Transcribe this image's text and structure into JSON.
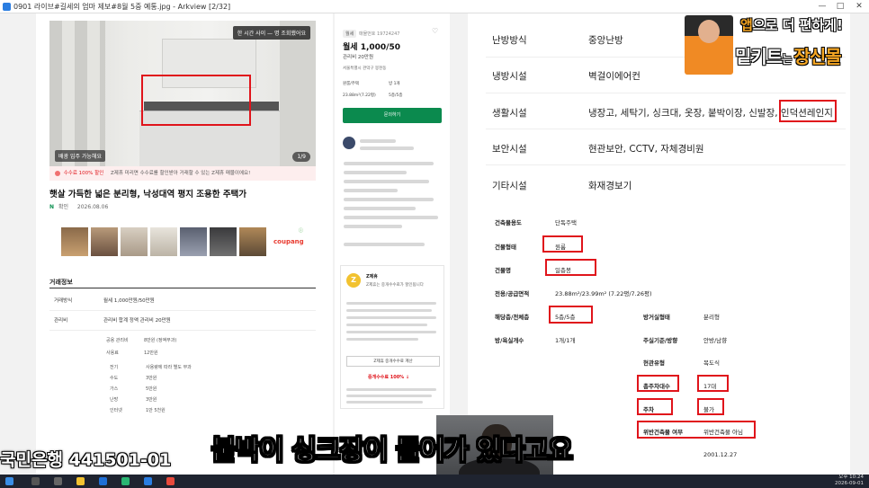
{
  "window": {
    "title": "0901 라이브#길세의 엄마 제보#8월 5중 예통.jpg - Arkview [2/32]",
    "min_btn": "—",
    "max_btn": "□",
    "close_btn": "✕"
  },
  "listing": {
    "photo_badge": "한 시간 사이 — 명 조회했어요",
    "photo_tag": "배광 입주 가능해요",
    "photo_count": "1/9",
    "notice_label": "수수료 100% 할인",
    "notice_text": "Z제휴 미리면 수수료를 할인받아 거래할 수 있는 Z제휴 매물이에요!",
    "title": "햇살 가득한 넓은 분리형, 낙성대역 평지 조용한 주택가",
    "verify_mark": "N",
    "verify_label": "확인",
    "verify_date": "2026.08.06",
    "ad_mark": "ⓘ",
    "coupang": "coupang",
    "section": "거래정보",
    "rows": [
      {
        "k": "거래방식",
        "v": "월세  1,000만원/50만원"
      },
      {
        "k": "관리비",
        "v": "관리비 합계     정액 관리비 20만원"
      }
    ],
    "sub_rows": [
      {
        "k": "공용 관리비",
        "v": "8만원 (정액부과)"
      },
      {
        "k": "사용료",
        "v": "12만원"
      },
      {
        "k": "전기",
        "v": "사용량에 따라 별도 부과"
      },
      {
        "k": "수도",
        "v": "3만원"
      },
      {
        "k": "가스",
        "v": "5만원"
      },
      {
        "k": "난방",
        "v": "3만원"
      },
      {
        "k": "인터넷",
        "v": "1만 5천원"
      }
    ]
  },
  "summary": {
    "chip": "월세",
    "regno": "매물번호 19724247",
    "heart": "♡",
    "price": "월세 1,000/50",
    "fee": "관리비 20만원",
    "addr": "서울특별시 관악구 봉천동",
    "specs": [
      "원룸/주택",
      "방 1개",
      "23.88m²(7.22평)",
      "5층/5층"
    ],
    "button": "문의하기",
    "z_logo": "Z",
    "z_title": "Z제휴",
    "z_sub": "Z제휴는 중개수수료가 할인됩니다",
    "z_btn": "Z제휴 중개수수료 계산",
    "z_pct": "중개수수료 100% ↓"
  },
  "details": {
    "big": [
      {
        "k": "난방방식",
        "v": "중앙난방"
      },
      {
        "k": "냉방시설",
        "v": "벽걸이에어컨"
      },
      {
        "k": "생활시설",
        "v": "냉장고, 세탁기, 싱크대, 옷장, 붙박이장, 신발장, 인덕션레인지"
      },
      {
        "k": "보안시설",
        "v": "현관보안, CCTV, 자체경비원"
      },
      {
        "k": "기타시설",
        "v": "화재경보기"
      }
    ],
    "small_left": [
      {
        "k": "건축물용도",
        "v": "단독주택"
      },
      {
        "k": "건물형태",
        "v": "원룸"
      },
      {
        "k": "건물명",
        "v": "일층봉"
      },
      {
        "k": "전용/공급면적",
        "v": "23.88m²/23.99m² (7.22평/7.26평)"
      },
      {
        "k": "해당층/전체층",
        "v": "5층/5층"
      },
      {
        "k": "방/욕실개수",
        "v": "1개/1개"
      }
    ],
    "small_right": [
      {
        "k": "방거실형태",
        "v": "분리형"
      },
      {
        "k": "주실기준/방향",
        "v": "안방/남향"
      },
      {
        "k": "현관유형",
        "v": "복도식"
      },
      {
        "k": "총주차대수",
        "v": "17대"
      },
      {
        "k": "주차",
        "v": "불가"
      },
      {
        "k": "위반건축물 여부",
        "v": "위반건축물 아님"
      },
      {
        "k": "",
        "v": "2001.12.27"
      }
    ]
  },
  "banner": {
    "line1_a": "앱",
    "line1_b": "으로 더 편하게!",
    "line2_a": "밑키트",
    "line2_b": "는 ",
    "line2_c": "장신몰"
  },
  "subtitle": {
    "account": "국민은행 441501-01",
    "caption": "붙박이 싱크장이 들어가 있다고요"
  },
  "taskbar": {
    "time": "오후 10:24",
    "date": "2026-09-01"
  }
}
